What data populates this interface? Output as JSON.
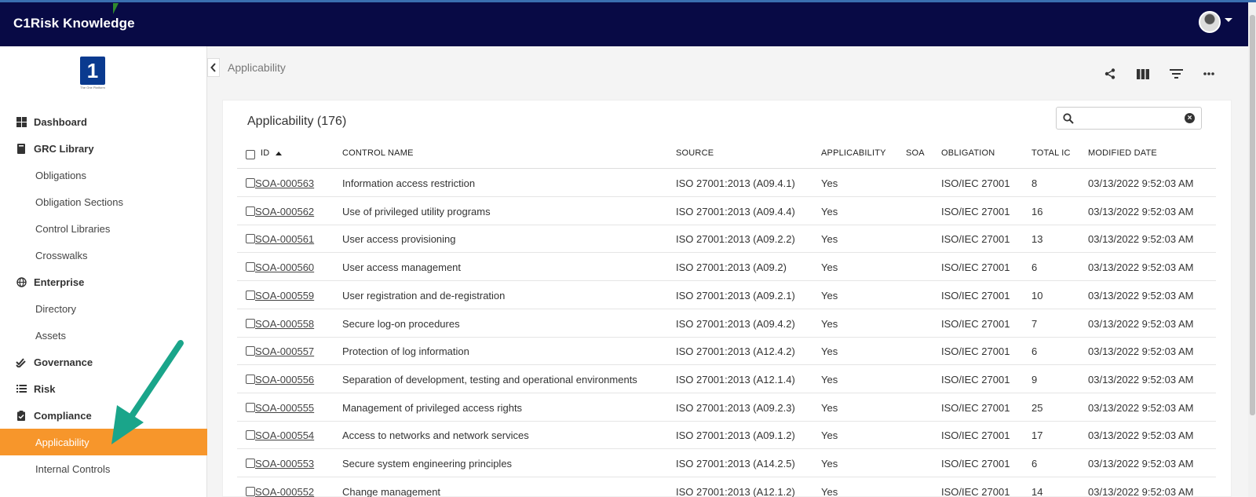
{
  "header": {
    "app_title": "C1Risk Knowledge"
  },
  "logo": {
    "glyph": "1",
    "caption": "The One Platform"
  },
  "sidebar": {
    "items": [
      {
        "label": "Dashboard",
        "icon": "dashboard-icon"
      },
      {
        "label": "GRC Library",
        "icon": "book-icon"
      },
      {
        "label": "Obligations"
      },
      {
        "label": "Obligation Sections"
      },
      {
        "label": "Control Libraries"
      },
      {
        "label": "Crosswalks"
      },
      {
        "label": "Enterprise",
        "icon": "globe-icon"
      },
      {
        "label": "Directory"
      },
      {
        "label": "Assets"
      },
      {
        "label": "Governance",
        "icon": "double-check-icon"
      },
      {
        "label": "Risk",
        "icon": "list-icon"
      },
      {
        "label": "Compliance",
        "icon": "clipboard-check-icon"
      },
      {
        "label": "Applicability",
        "active": true
      },
      {
        "label": "Internal Controls"
      }
    ]
  },
  "breadcrumb": {
    "label": "Applicability"
  },
  "toolbar": {
    "icons": [
      "share-icon",
      "columns-icon",
      "filter-icon",
      "more-icon"
    ]
  },
  "card": {
    "title": "Applicability (176)"
  },
  "search": {
    "placeholder": "",
    "value": ""
  },
  "table": {
    "columns": [
      "ID",
      "CONTROL NAME",
      "SOURCE",
      "APPLICABILITY",
      "SOA",
      "OBLIGATION",
      "TOTAL IC",
      "MODIFIED DATE"
    ],
    "sort": {
      "column": "ID",
      "direction": "asc"
    },
    "rows": [
      [
        "SOA-000563",
        "Information access restriction",
        "ISO 27001:2013 (A09.4.1)",
        "Yes",
        "",
        "ISO/IEC 27001",
        "8",
        "03/13/2022 9:52:03 AM"
      ],
      [
        "SOA-000562",
        "Use of privileged utility programs",
        "ISO 27001:2013 (A09.4.4)",
        "Yes",
        "",
        "ISO/IEC 27001",
        "16",
        "03/13/2022 9:52:03 AM"
      ],
      [
        "SOA-000561",
        "User access provisioning",
        "ISO 27001:2013 (A09.2.2)",
        "Yes",
        "",
        "ISO/IEC 27001",
        "13",
        "03/13/2022 9:52:03 AM"
      ],
      [
        "SOA-000560",
        "User access management",
        "ISO 27001:2013 (A09.2)",
        "Yes",
        "",
        "ISO/IEC 27001",
        "6",
        "03/13/2022 9:52:03 AM"
      ],
      [
        "SOA-000559",
        "User registration and de-registration",
        "ISO 27001:2013 (A09.2.1)",
        "Yes",
        "",
        "ISO/IEC 27001",
        "10",
        "03/13/2022 9:52:03 AM"
      ],
      [
        "SOA-000558",
        "Secure log-on procedures",
        "ISO 27001:2013 (A09.4.2)",
        "Yes",
        "",
        "ISO/IEC 27001",
        "7",
        "03/13/2022 9:52:03 AM"
      ],
      [
        "SOA-000557",
        "Protection of log information",
        "ISO 27001:2013 (A12.4.2)",
        "Yes",
        "",
        "ISO/IEC 27001",
        "6",
        "03/13/2022 9:52:03 AM"
      ],
      [
        "SOA-000556",
        "Separation of development, testing and operational environments",
        "ISO 27001:2013 (A12.1.4)",
        "Yes",
        "",
        "ISO/IEC 27001",
        "9",
        "03/13/2022 9:52:03 AM"
      ],
      [
        "SOA-000555",
        "Management of privileged access rights",
        "ISO 27001:2013 (A09.2.3)",
        "Yes",
        "",
        "ISO/IEC 27001",
        "25",
        "03/13/2022 9:52:03 AM"
      ],
      [
        "SOA-000554",
        "Access to networks and network services",
        "ISO 27001:2013 (A09.1.2)",
        "Yes",
        "",
        "ISO/IEC 27001",
        "17",
        "03/13/2022 9:52:03 AM"
      ],
      [
        "SOA-000553",
        "Secure system engineering principles",
        "ISO 27001:2013 (A14.2.5)",
        "Yes",
        "",
        "ISO/IEC 27001",
        "6",
        "03/13/2022 9:52:03 AM"
      ],
      [
        "SOA-000552",
        "Change management",
        "ISO 27001:2013 (A12.1.2)",
        "Yes",
        "",
        "ISO/IEC 27001",
        "14",
        "03/13/2022 9:52:03 AM"
      ]
    ]
  },
  "colors": {
    "topbar": "#080a45",
    "active_nav": "#f7962b",
    "arrow": "#1aa58a"
  }
}
